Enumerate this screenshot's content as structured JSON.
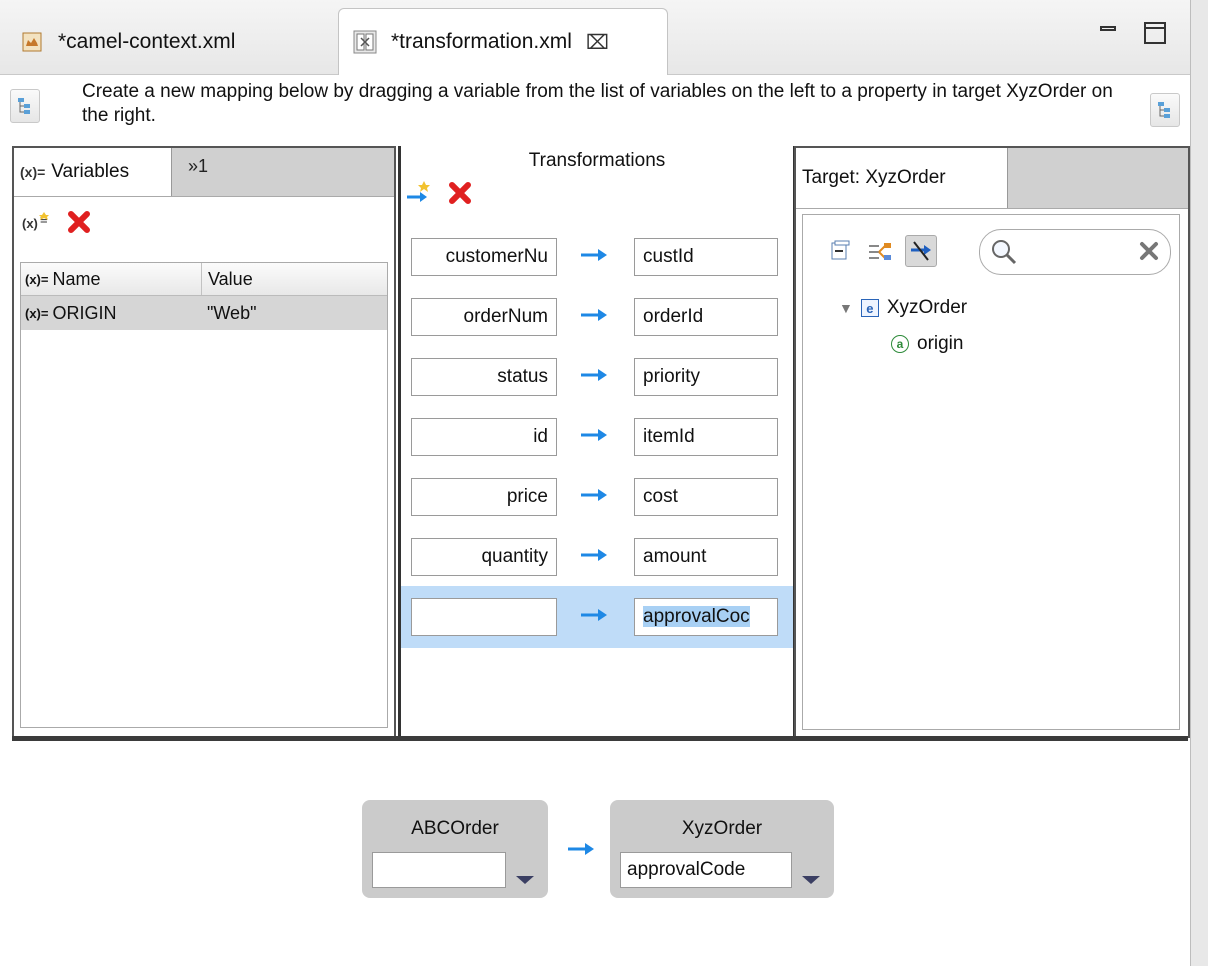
{
  "editor_tabs": [
    {
      "label": "*camel-context.xml",
      "icon": "camel-file-icon",
      "active": false
    },
    {
      "label": "*transformation.xml",
      "icon": "transformation-file-icon",
      "active": true,
      "close_glyph": "⌧"
    }
  ],
  "instruction": "Create a new mapping below by dragging a variable from the list of variables on the left to a property in target XyzOrder on the right.",
  "variables_panel": {
    "tab_label": "Variables",
    "tab_icon_text": "(x)=",
    "overflow_label": "»1",
    "columns": {
      "name": "Name",
      "value": "Value"
    },
    "rows": [
      {
        "name": "ORIGIN",
        "value": "\"Web\""
      }
    ]
  },
  "transformations": {
    "title": "Transformations",
    "mappings": [
      {
        "source": "customerNu",
        "target": "custId"
      },
      {
        "source": "orderNum",
        "target": "orderId"
      },
      {
        "source": "status",
        "target": "priority"
      },
      {
        "source": "id",
        "target": "itemId"
      },
      {
        "source": "price",
        "target": "cost"
      },
      {
        "source": "quantity",
        "target": "amount"
      },
      {
        "source": "",
        "target": "approvalCoc",
        "selected": true
      }
    ]
  },
  "target_panel": {
    "tab_label": "Target: XyzOrder",
    "tree": {
      "root": {
        "label": "XyzOrder",
        "icon_text": "e"
      },
      "child": {
        "label": "origin",
        "icon_text": "a"
      }
    }
  },
  "mapping_detail": {
    "source": {
      "title": "ABCOrder",
      "value": ""
    },
    "target": {
      "title": "XyzOrder",
      "value": "approvalCode"
    }
  },
  "colors": {
    "arrow": "#1e88e5",
    "selected_row": "#bfdcf8",
    "delete": "#e02020"
  }
}
